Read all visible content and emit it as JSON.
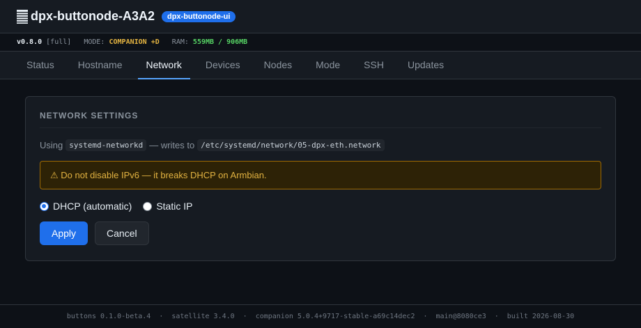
{
  "header": {
    "title": "dpx-buttonode-A3A2",
    "badge": "dpx-buttonode-ui",
    "icon": "server-icon"
  },
  "statusbar": {
    "version": "v0.8.0",
    "variant": "[full]",
    "mode_label": "MODE:",
    "mode_value": "COMPANION +D",
    "ram_label": "RAM:",
    "ram_value": "559MB / 906MB"
  },
  "tabs": [
    {
      "label": "Status"
    },
    {
      "label": "Hostname"
    },
    {
      "label": "Network",
      "active": true
    },
    {
      "label": "Devices"
    },
    {
      "label": "Nodes"
    },
    {
      "label": "Mode"
    },
    {
      "label": "SSH"
    },
    {
      "label": "Updates"
    }
  ],
  "network": {
    "title": "NETWORK SETTINGS",
    "using_prefix": "Using",
    "service": "systemd-networkd",
    "writes_to": "— writes to",
    "config_path": "/etc/systemd/network/05-dpx-eth.network",
    "warning": "⚠ Do not disable IPv6 — it breaks DHCP on Armbian.",
    "options": [
      {
        "label": "DHCP (automatic)",
        "checked": true
      },
      {
        "label": "Static IP",
        "checked": false
      }
    ],
    "apply_label": "Apply",
    "cancel_label": "Cancel"
  },
  "footer": {
    "items": [
      "buttons 0.1.0-beta.4",
      "satellite 3.4.0",
      "companion 5.0.4+9717-stable-a69c14dec2",
      "main@8080ce3",
      "built 2026-08-30"
    ],
    "separator": "·"
  },
  "colors": {
    "accent": "#1f6feb",
    "warning": "#e3b341",
    "ram": "#56d364"
  }
}
